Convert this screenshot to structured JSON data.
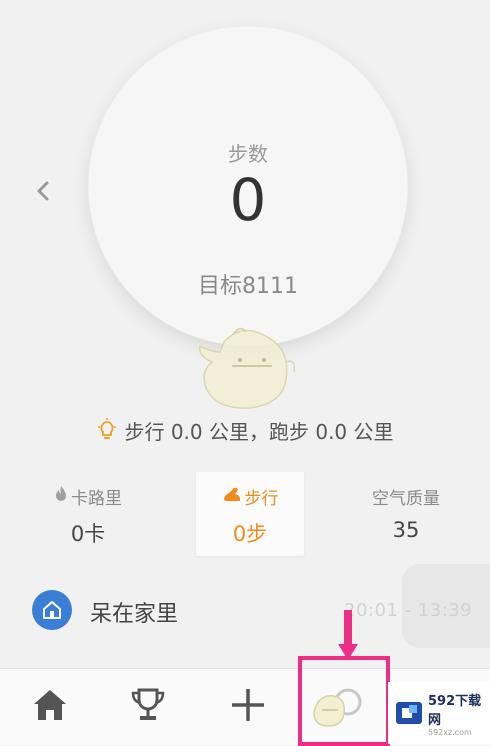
{
  "step_ring": {
    "label": "步数",
    "value": "0",
    "goal": "目标8111"
  },
  "distance": {
    "text": "步行 0.0 公里，跑步 0.0 公里"
  },
  "stats": [
    {
      "label": "卡路里",
      "value": "0卡",
      "icon": "flame-icon"
    },
    {
      "label": "步行",
      "value": "0步",
      "icon": "shoe-icon"
    },
    {
      "label": "空气质量",
      "value": "35"
    }
  ],
  "status": {
    "text": "呆在家里",
    "time": "20:01 - 13:39",
    "icon": "home-icon"
  },
  "tabs": [
    {
      "name": "home",
      "icon": "house-icon"
    },
    {
      "name": "trophy",
      "icon": "trophy-icon"
    },
    {
      "name": "add",
      "icon": "plus-icon"
    },
    {
      "name": "me",
      "icon": "profile-icon"
    }
  ],
  "watermark": {
    "title": "592下载网",
    "sub": "592xz.com"
  },
  "colors": {
    "accent": "#f08c1a",
    "home_badge": "#3a7fd5",
    "highlight": "#ec2e86"
  }
}
